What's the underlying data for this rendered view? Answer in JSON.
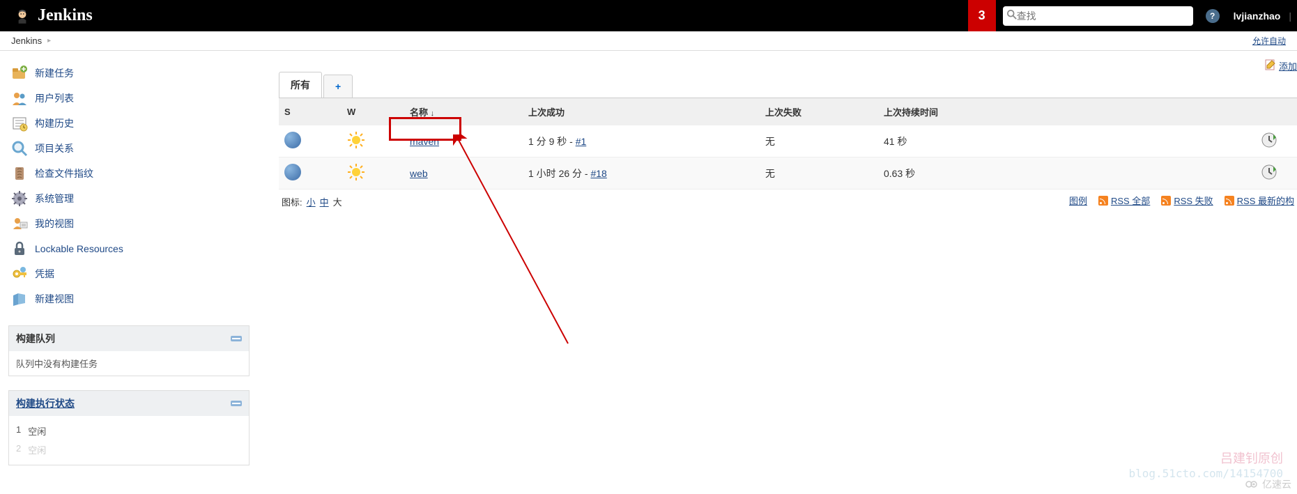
{
  "header": {
    "logo_text": "Jenkins",
    "notif_count": "3",
    "search_placeholder": "查找",
    "username": "lvjianzhao"
  },
  "breadcrumb": {
    "root": "Jenkins",
    "right_link": "允许自动"
  },
  "sidebar": {
    "items": [
      {
        "label": "新建任务",
        "icon": "new-item-icon"
      },
      {
        "label": "用户列表",
        "icon": "people-icon"
      },
      {
        "label": "构建历史",
        "icon": "build-history-icon"
      },
      {
        "label": "项目关系",
        "icon": "project-rel-icon"
      },
      {
        "label": "检查文件指纹",
        "icon": "fingerprint-icon"
      },
      {
        "label": "系统管理",
        "icon": "manage-icon"
      },
      {
        "label": "我的视图",
        "icon": "my-views-icon"
      },
      {
        "label": "Lockable Resources",
        "icon": "lock-icon"
      },
      {
        "label": "凭据",
        "icon": "credentials-icon"
      },
      {
        "label": "新建视图",
        "icon": "new-view-icon"
      }
    ],
    "build_queue": {
      "title": "构建队列",
      "empty_text": "队列中没有构建任务"
    },
    "executor": {
      "title": "构建执行状态",
      "rows": [
        {
          "num": "1",
          "status": "空闲"
        },
        {
          "num": "2",
          "status": "空闲"
        }
      ]
    }
  },
  "content": {
    "add_description": "添加",
    "tabs": {
      "all": "所有",
      "add": "+"
    },
    "columns": {
      "s": "S",
      "w": "W",
      "name": "名称",
      "sort": "↓",
      "last_success": "上次成功",
      "last_failure": "上次失败",
      "last_duration": "上次持续时间"
    },
    "jobs": [
      {
        "name": "maven",
        "last_success_text": "1 分 9 秒 - ",
        "last_success_build": "#1",
        "last_failure": "无",
        "last_duration": "41 秒"
      },
      {
        "name": "web",
        "last_success_text": "1 小时 26 分 - ",
        "last_success_build": "#18",
        "last_failure": "无",
        "last_duration": "0.63 秒"
      }
    ],
    "icon_size": {
      "label": "图标:",
      "small": "小",
      "medium": "中",
      "large": "大"
    },
    "rss": {
      "legend": "图例",
      "all": "RSS 全部",
      "failed": "RSS 失败",
      "latest": "RSS 最新的构"
    }
  },
  "watermark": {
    "line1": "吕建钊原创",
    "line2": "blog.51cto.com/14154700"
  },
  "corner": "亿速云"
}
